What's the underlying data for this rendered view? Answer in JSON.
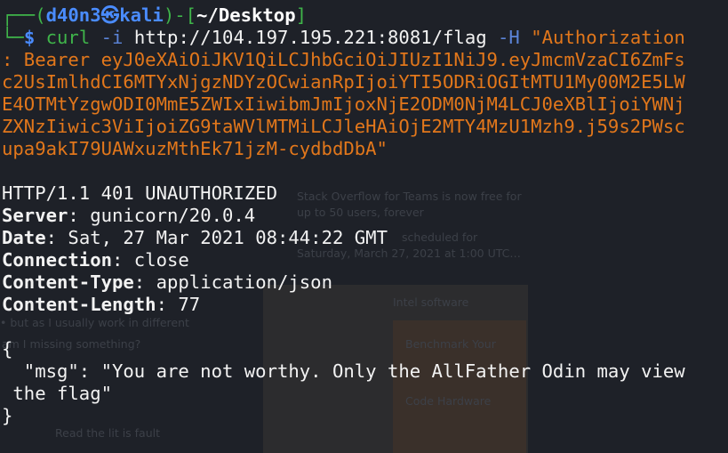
{
  "prompt": {
    "corner_top": "┌──(",
    "user": "d40n3",
    "skull": "㉿",
    "host": "kali",
    "sep": ")-[",
    "path": "~/Desktop",
    "close": "]",
    "corner_bottom": "└─",
    "dollar": "$"
  },
  "command": {
    "program": "curl",
    "opt_i": "-i",
    "url": "http://104.197.195.221:8081/flag",
    "opt_h": "-H",
    "header_lines": [
      "\"Authorization",
      ": Bearer eyJ0eXAiOiJKV1QiLCJhbGciOiJIUzI1NiJ9.eyJmcmVzaCI6ZmFs",
      "c2UsImlhdCI6MTYxNjgzNDYzOCwianRpIjoiYTI5ODRiOGItMTU1My00M2E5LW",
      "E4OTMtYzgwODI0MmE5ZWIxIiwibmJmIjoxNjE2ODM0NjM4LCJ0eXBlIjoiYWNj",
      "ZXNzIiwic3ViIjoiZG9taWVlMTMiLCJleHAiOjE2MTY4MzU1Mzh9.j59s2PWsc",
      "upa9akI79UAWxuzMthEk71jzM-cydbdDbA\""
    ]
  },
  "response": {
    "status": "HTTP/1.1 401 UNAUTHORIZED",
    "headers": [
      {
        "name": "Server",
        "value": " gunicorn/20.0.4"
      },
      {
        "name": "Date",
        "value": " Sat, 27 Mar 2021 08:44:22 GMT"
      },
      {
        "name": "Connection",
        "value": " close"
      },
      {
        "name": "Content-Type",
        "value": " application/json"
      },
      {
        "name": "Content-Length",
        "value": " 77"
      }
    ],
    "body_lines": [
      "{",
      "  \"msg\": \"You are not worthy. Only the AllFather Odin may view",
      " the flag\"",
      "}"
    ]
  },
  "background_page": {
    "lines": [
      "Stack Overflow for Teams is now free for",
      "up to 50 users, forever",
      "scheduled for",
      "Saturday, March 27, 2021 at 1:00 UTC…",
      "Intel software",
      "• but as I usually work in different",
      "am I missing something?",
      "Benchmark Your",
      "Code Hardware",
      "Read the lit is fault"
    ]
  },
  "colors": {
    "background": "#1e2128",
    "prompt_green": "#3fb54a",
    "prompt_blue": "#4a8cff",
    "string_orange": "#e2771b",
    "text_white": "#f2f2f2"
  }
}
